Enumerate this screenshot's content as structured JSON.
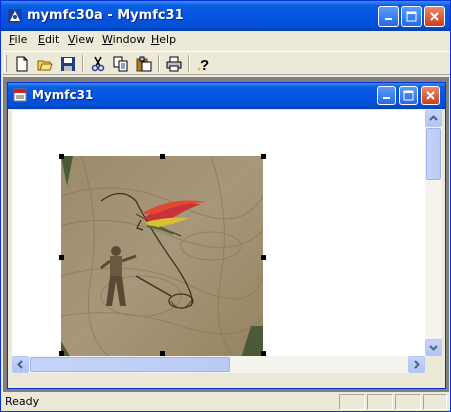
{
  "app": {
    "title": "mymfc30a - Mymfc31",
    "icon": "app-icon"
  },
  "menu": [
    {
      "pre": "",
      "u": "F",
      "post": "ile"
    },
    {
      "pre": "",
      "u": "E",
      "post": "dit"
    },
    {
      "pre": "",
      "u": "V",
      "post": "iew"
    },
    {
      "pre": "",
      "u": "W",
      "post": "indow"
    },
    {
      "pre": "",
      "u": "H",
      "post": "elp"
    }
  ],
  "toolbar": {
    "buttons": [
      "new-icon",
      "open-icon",
      "save-icon",
      "cut-icon",
      "copy-icon",
      "paste-icon",
      "print-icon",
      "help-icon"
    ]
  },
  "child": {
    "title": "Mymfc31",
    "icon": "document-icon",
    "image": "fly-fishing-picture"
  },
  "status": {
    "text": "Ready"
  },
  "colors": {
    "titlebar": "#0554e3",
    "close_button": "#c8401e",
    "face": "#ece9d8"
  }
}
